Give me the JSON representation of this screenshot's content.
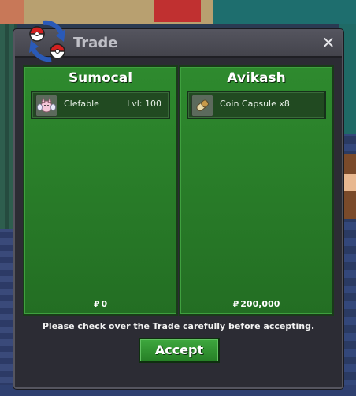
{
  "window": {
    "title": "Trade",
    "close_label": "✕"
  },
  "left": {
    "player": "Sumocal",
    "item": {
      "name": "Clefable",
      "level": "Lvl: 100",
      "icon": "clefable-icon"
    },
    "money_symbol": "₽",
    "money": "0"
  },
  "right": {
    "player": "Avikash",
    "item": {
      "name": "Coin Capsule x8",
      "icon": "coin-capsule-icon"
    },
    "money_symbol": "₽",
    "money": "200,000"
  },
  "notice": "Please check over the Trade carefully before accepting.",
  "accept_label": "Accept",
  "colors": {
    "panel_green": "#2e8a2e",
    "window_bg": "#2c2c34",
    "titlebar": "#4c4c56"
  }
}
